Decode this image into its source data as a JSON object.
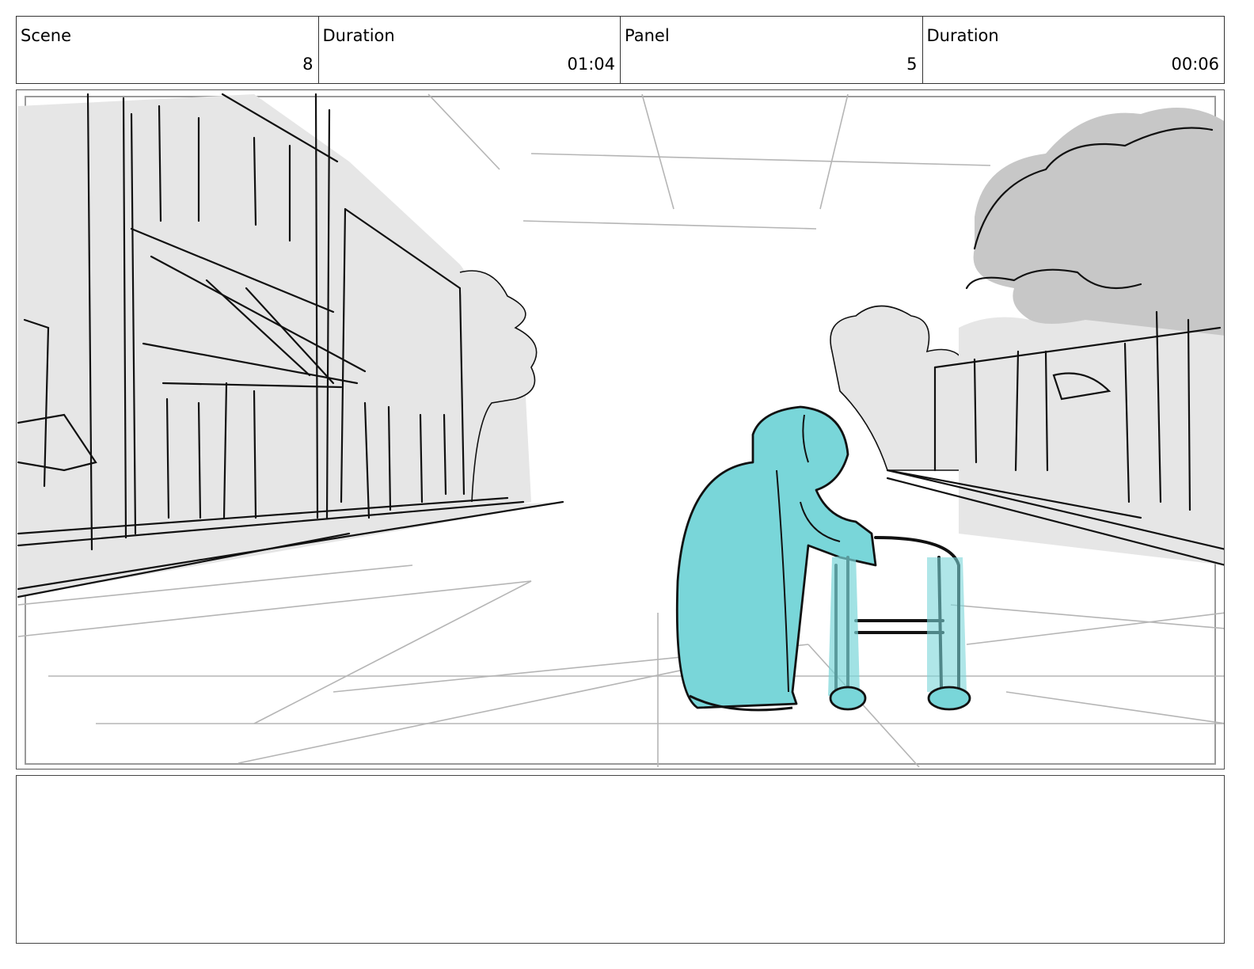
{
  "header": {
    "cells": [
      {
        "label": "Scene",
        "value": "8"
      },
      {
        "label": "Duration",
        "value": "01:04"
      },
      {
        "label": "Panel",
        "value": "5"
      },
      {
        "label": "Duration",
        "value": "00:06"
      }
    ]
  },
  "panel": {
    "icons": [
      "street-sketch",
      "elderly-woman-with-walker"
    ]
  },
  "colors": {
    "figure_fill": "#79d6d9",
    "building_gray": "#e6e6e6",
    "tree_gray": "#c7c7c7",
    "ink": "#111111"
  },
  "notes": {
    "text": ""
  }
}
